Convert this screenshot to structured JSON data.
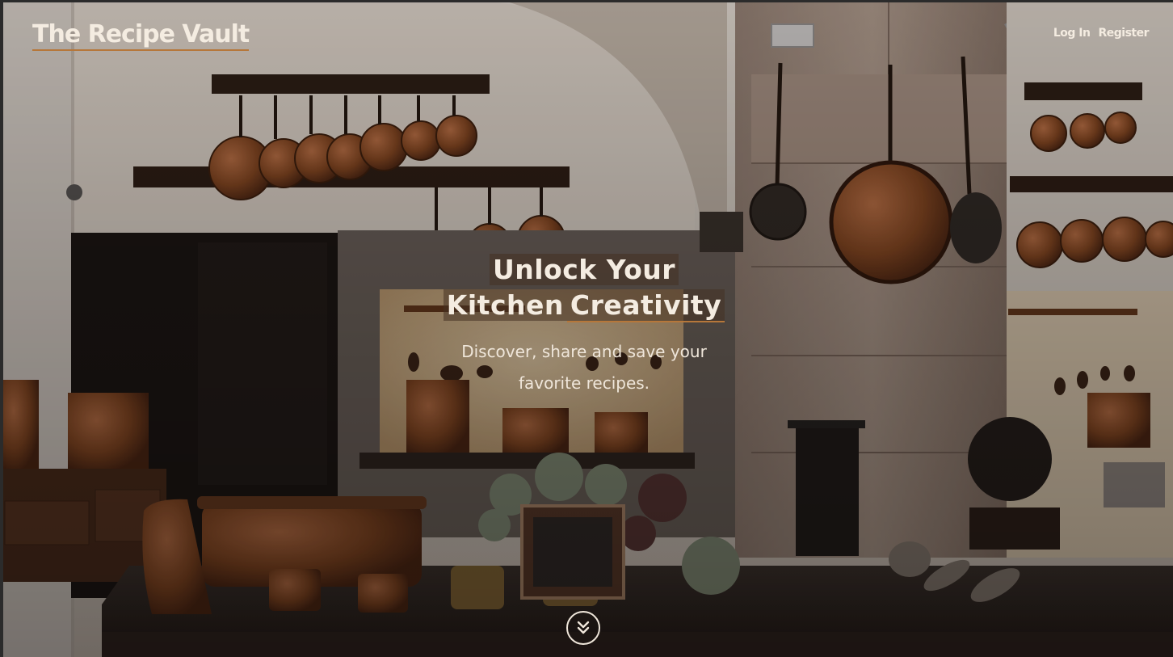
{
  "header": {
    "brand": "The Recipe Vault",
    "nav": {
      "login": "Log In",
      "register": "Register"
    }
  },
  "hero": {
    "title_line1": "Unlock Your",
    "title_line2_a": "Kitchen",
    "title_line2_b": "Creativity",
    "subtitle_line1": "Discover, share and save your",
    "subtitle_line2": "favorite recipes."
  },
  "scroll": {
    "icon": "double-chevron-down-icon"
  },
  "colors": {
    "accent": "#b6773a",
    "text": "#f4ece1",
    "copper": "#8a4a22"
  }
}
